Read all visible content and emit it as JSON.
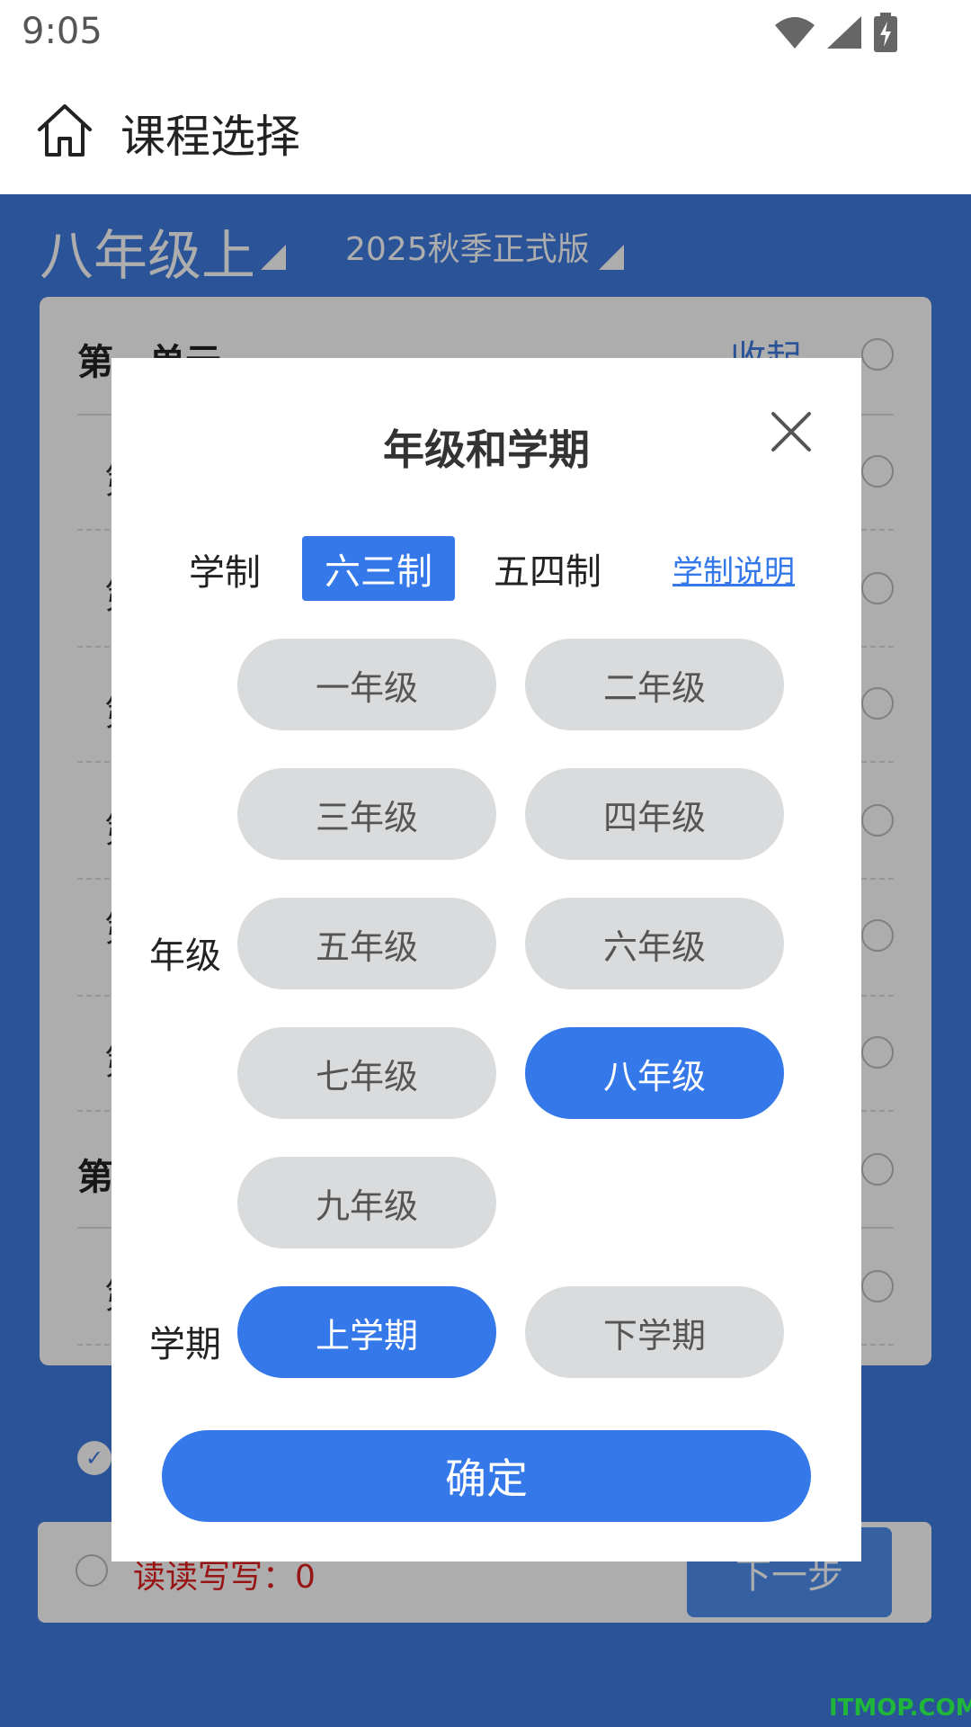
{
  "status_bar": {
    "time": "9:05",
    "icons": [
      "wifi-icon",
      "signal-icon",
      "battery-charging-icon"
    ]
  },
  "app_bar": {
    "title": "课程选择",
    "home_icon": "home-icon"
  },
  "background": {
    "grade": "八年级上",
    "edition": "2025秋季正式版",
    "unit1": "第一单元",
    "collapse": "收起",
    "unit2": "第",
    "row_stub": "第",
    "typo_count": "读读写写：0",
    "next": "下一步"
  },
  "dialog": {
    "title": "年级和学期",
    "close_icon": "close-icon",
    "system": {
      "label": "学制",
      "options": [
        "六三制",
        "五四制"
      ],
      "selected": "六三制",
      "help_link": "学制说明"
    },
    "grade": {
      "label": "年级",
      "options": [
        "一年级",
        "二年级",
        "三年级",
        "四年级",
        "五年级",
        "六年级",
        "七年级",
        "八年级",
        "九年级"
      ],
      "selected": "八年级"
    },
    "term": {
      "label": "学期",
      "options": [
        "上学期",
        "下学期"
      ],
      "selected": "上学期"
    },
    "confirm": "确定"
  },
  "watermark": "ITMOP.COM",
  "colors": {
    "primary": "#3478ea",
    "pill_inactive": "#dadbdc",
    "background_blue": "#3f7be0"
  }
}
